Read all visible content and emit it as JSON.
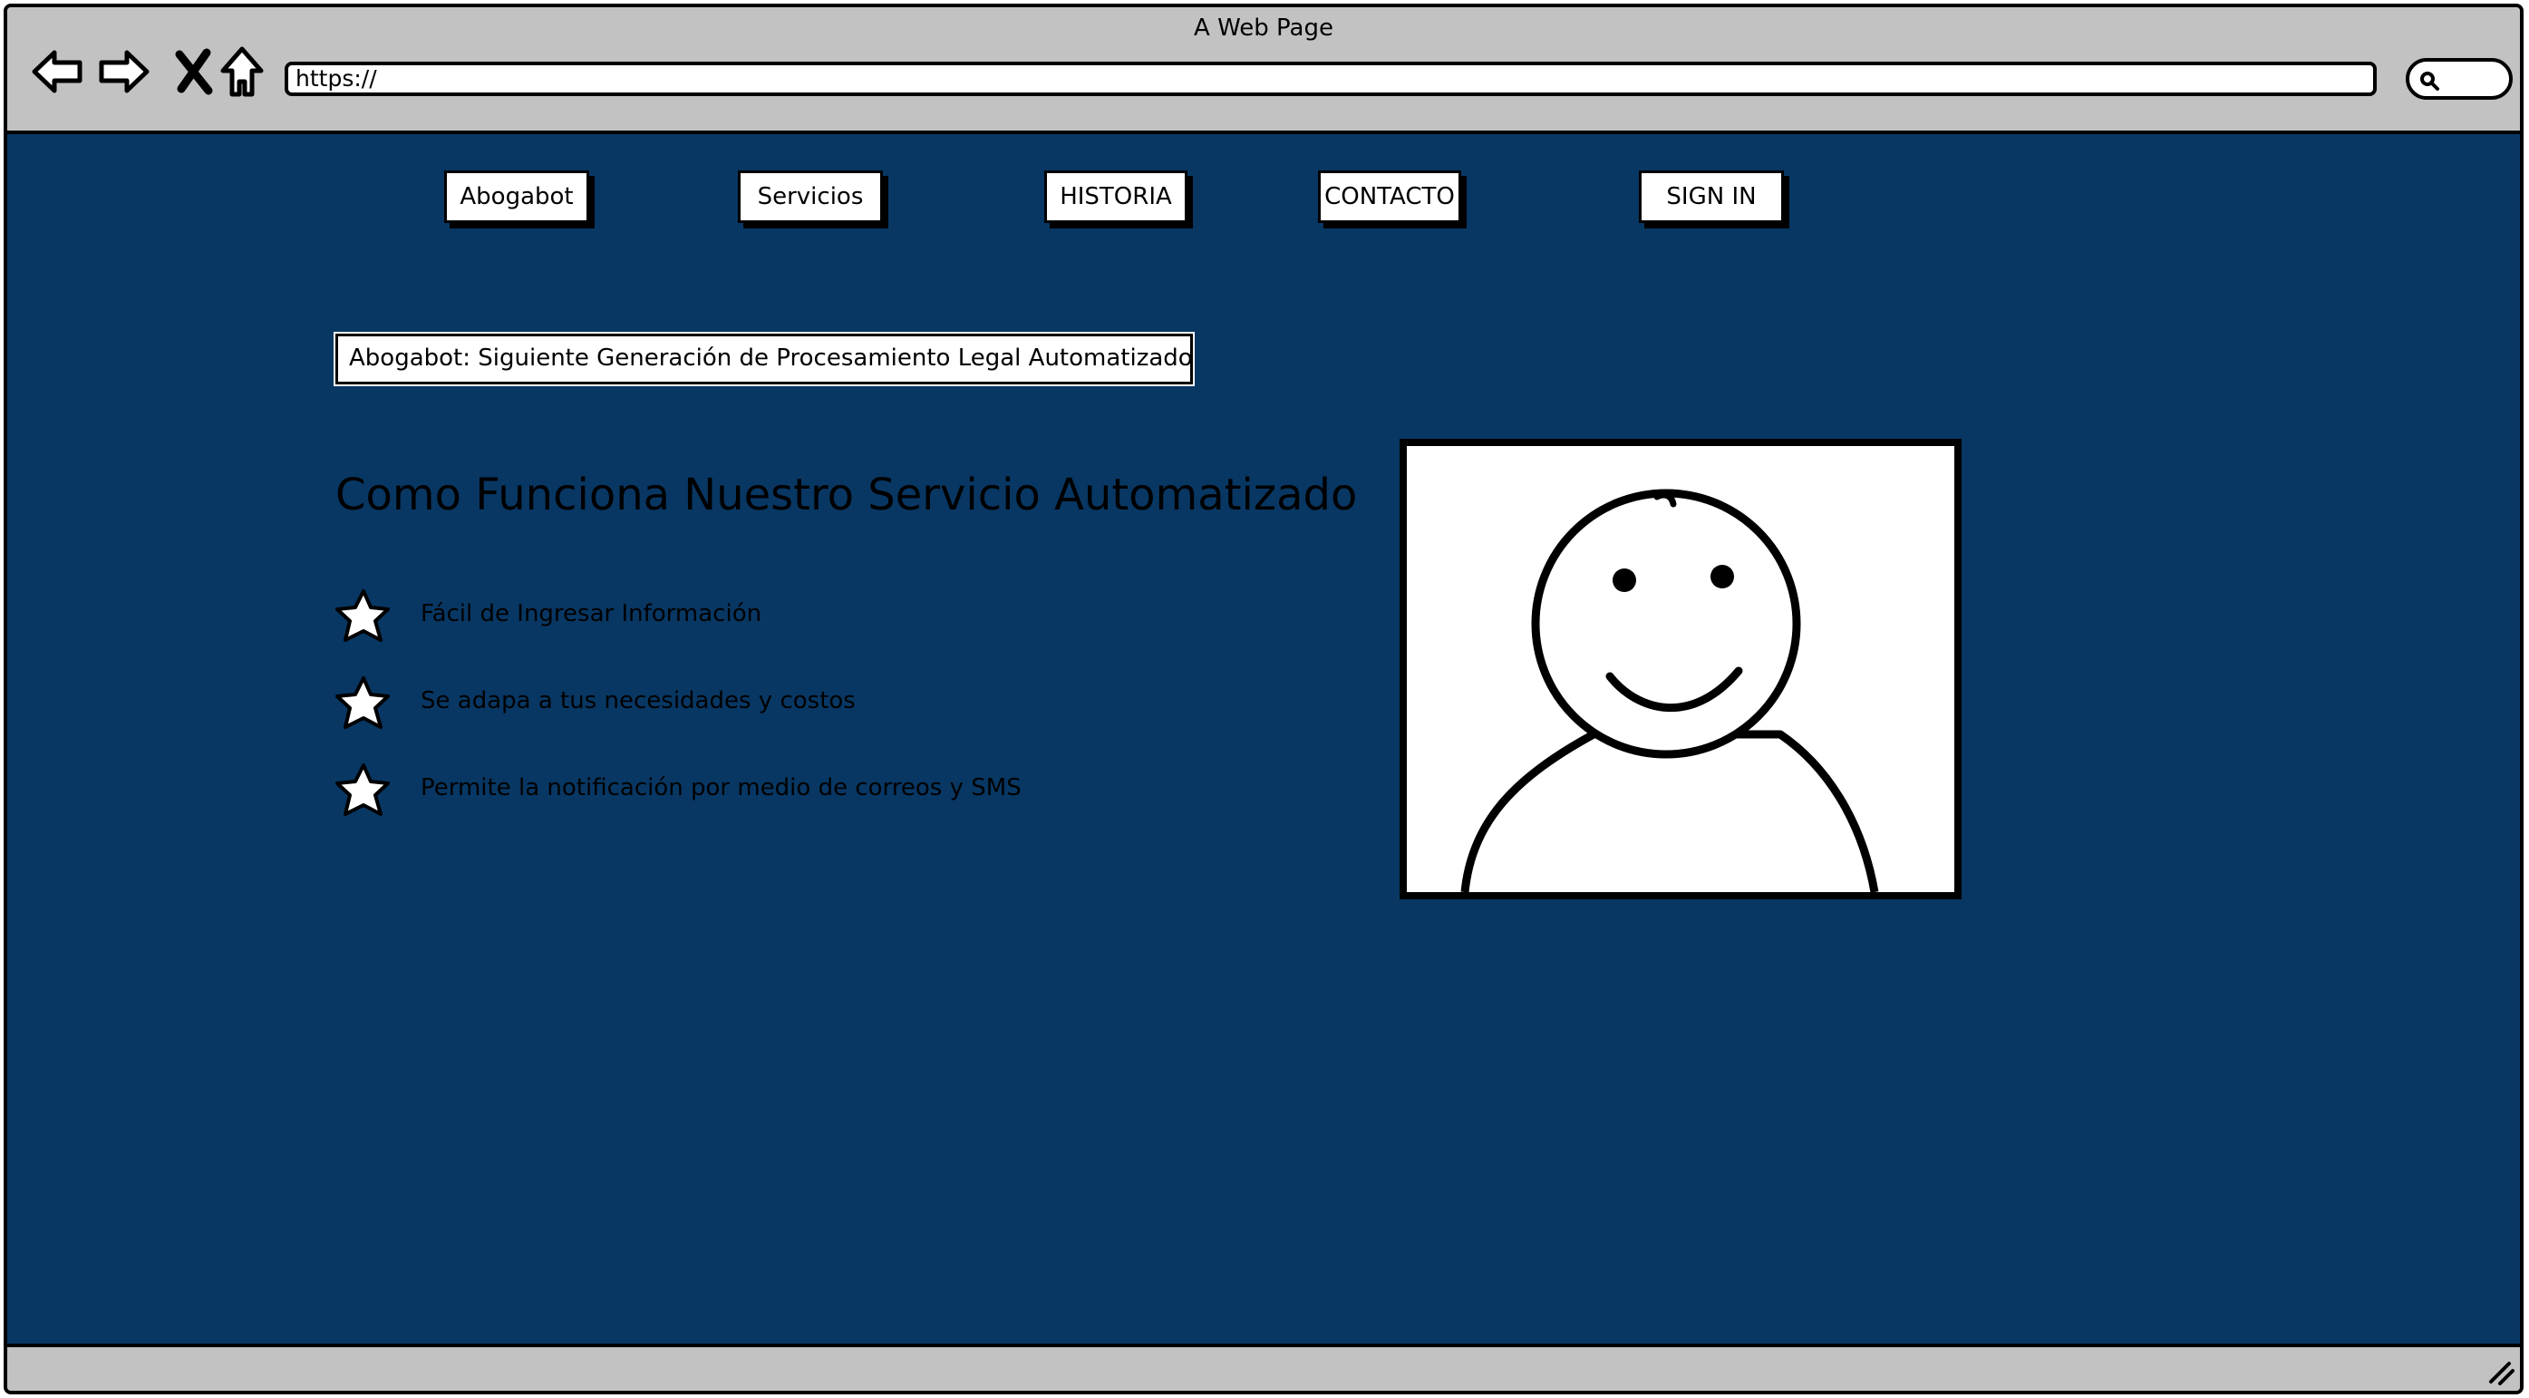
{
  "window": {
    "title": "A Web Page"
  },
  "browser": {
    "url": "https://",
    "nav_icons": [
      "back-arrow-icon",
      "forward-arrow-icon",
      "close-x-icon",
      "home-icon"
    ],
    "search_icon": "search-icon"
  },
  "nav": {
    "items": [
      {
        "label": "Abogabot"
      },
      {
        "label": "Servicios"
      },
      {
        "label": "HISTORIA"
      },
      {
        "label": "CONTACTO"
      },
      {
        "label": "SIGN IN"
      }
    ]
  },
  "main": {
    "tagline": "Abogabot: Siguiente Generación de Procesamiento Legal Automatizado",
    "heading": "Como Funciona Nuestro Servicio Automatizado",
    "features": [
      {
        "icon": "star-icon",
        "text": "Fácil de Ingresar Información"
      },
      {
        "icon": "star-icon",
        "text": "Se adapa a tus necesidades y costos"
      },
      {
        "icon": "star-icon",
        "text": "Permite la notificación por medio de correos y SMS"
      }
    ],
    "image_icon": "smiley-person-icon"
  },
  "colors": {
    "background": "#083763",
    "chrome": "#c2c2c2",
    "outline": "#000000",
    "surface": "#ffffff"
  }
}
